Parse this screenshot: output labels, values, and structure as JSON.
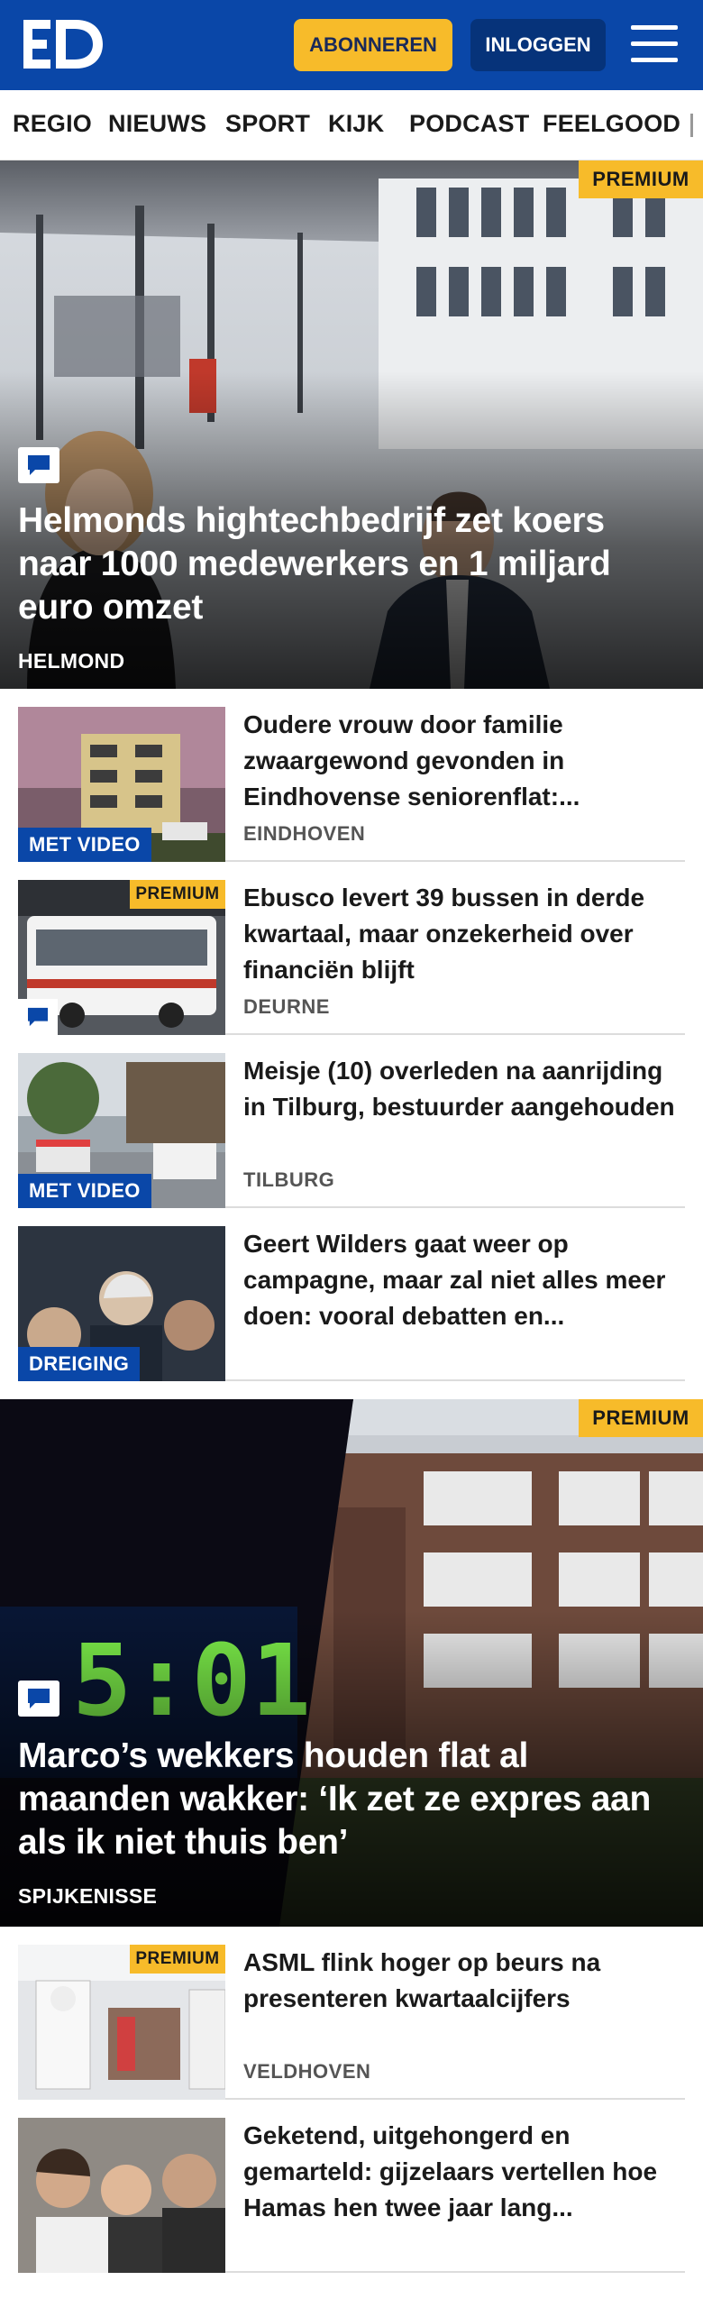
{
  "header": {
    "logo_text": "ED",
    "subscribe_label": "ABONNEREN",
    "login_label": "INLOGGEN",
    "menu_icon": "hamburger-icon",
    "brand_color": "#0a47a8",
    "accent_color": "#f7bb2a"
  },
  "nav": {
    "items": [
      "REGIO",
      "NIEUWS",
      "SPORT",
      "KIJK",
      "PODCAST",
      "FEELGOOD"
    ]
  },
  "hero1": {
    "badge": "PREMIUM",
    "comment_icon": "comment-icon",
    "title": "Helmonds hightechbedrijf zet koers naar 1000 medewerkers en 1 miljard euro omzet",
    "location": "HELMOND"
  },
  "list1": [
    {
      "label": "MET VIDEO",
      "title": "Oudere vrouw door familie zwaargewond gevonden in Eindhovense seniorenflat:...",
      "location": "EINDHOVEN"
    },
    {
      "badge": "PREMIUM",
      "comment_icon": "comment-icon",
      "title": "Ebusco levert 39 bussen in derde kwartaal, maar onzekerheid over financiën blijft",
      "location": "DEURNE"
    },
    {
      "label": "MET VIDEO",
      "title": "Meisje (10) overleden na aanrijding in Tilburg, bestuurder aangehouden",
      "location": "TILBURG"
    },
    {
      "label": "DREIGING",
      "title": "Geert Wilders gaat weer op campagne, maar zal niet alles meer doen: vooral debatten en..."
    }
  ],
  "hero2": {
    "badge": "PREMIUM",
    "comment_icon": "comment-icon",
    "clock_text": "5:01",
    "title": "Marco’s wekkers houden flat al maanden wakker: ‘Ik zet ze expres aan als ik niet thuis ben’",
    "location": "SPIJKENISSE"
  },
  "list2": [
    {
      "badge": "PREMIUM",
      "title": "ASML flink hoger op beurs na presenteren kwartaalcijfers",
      "location": "VELDHOVEN"
    },
    {
      "title": "Geketend, uitgehongerd en gemarteld: gijzelaars vertellen hoe Hamas hen twee jaar lang..."
    }
  ]
}
